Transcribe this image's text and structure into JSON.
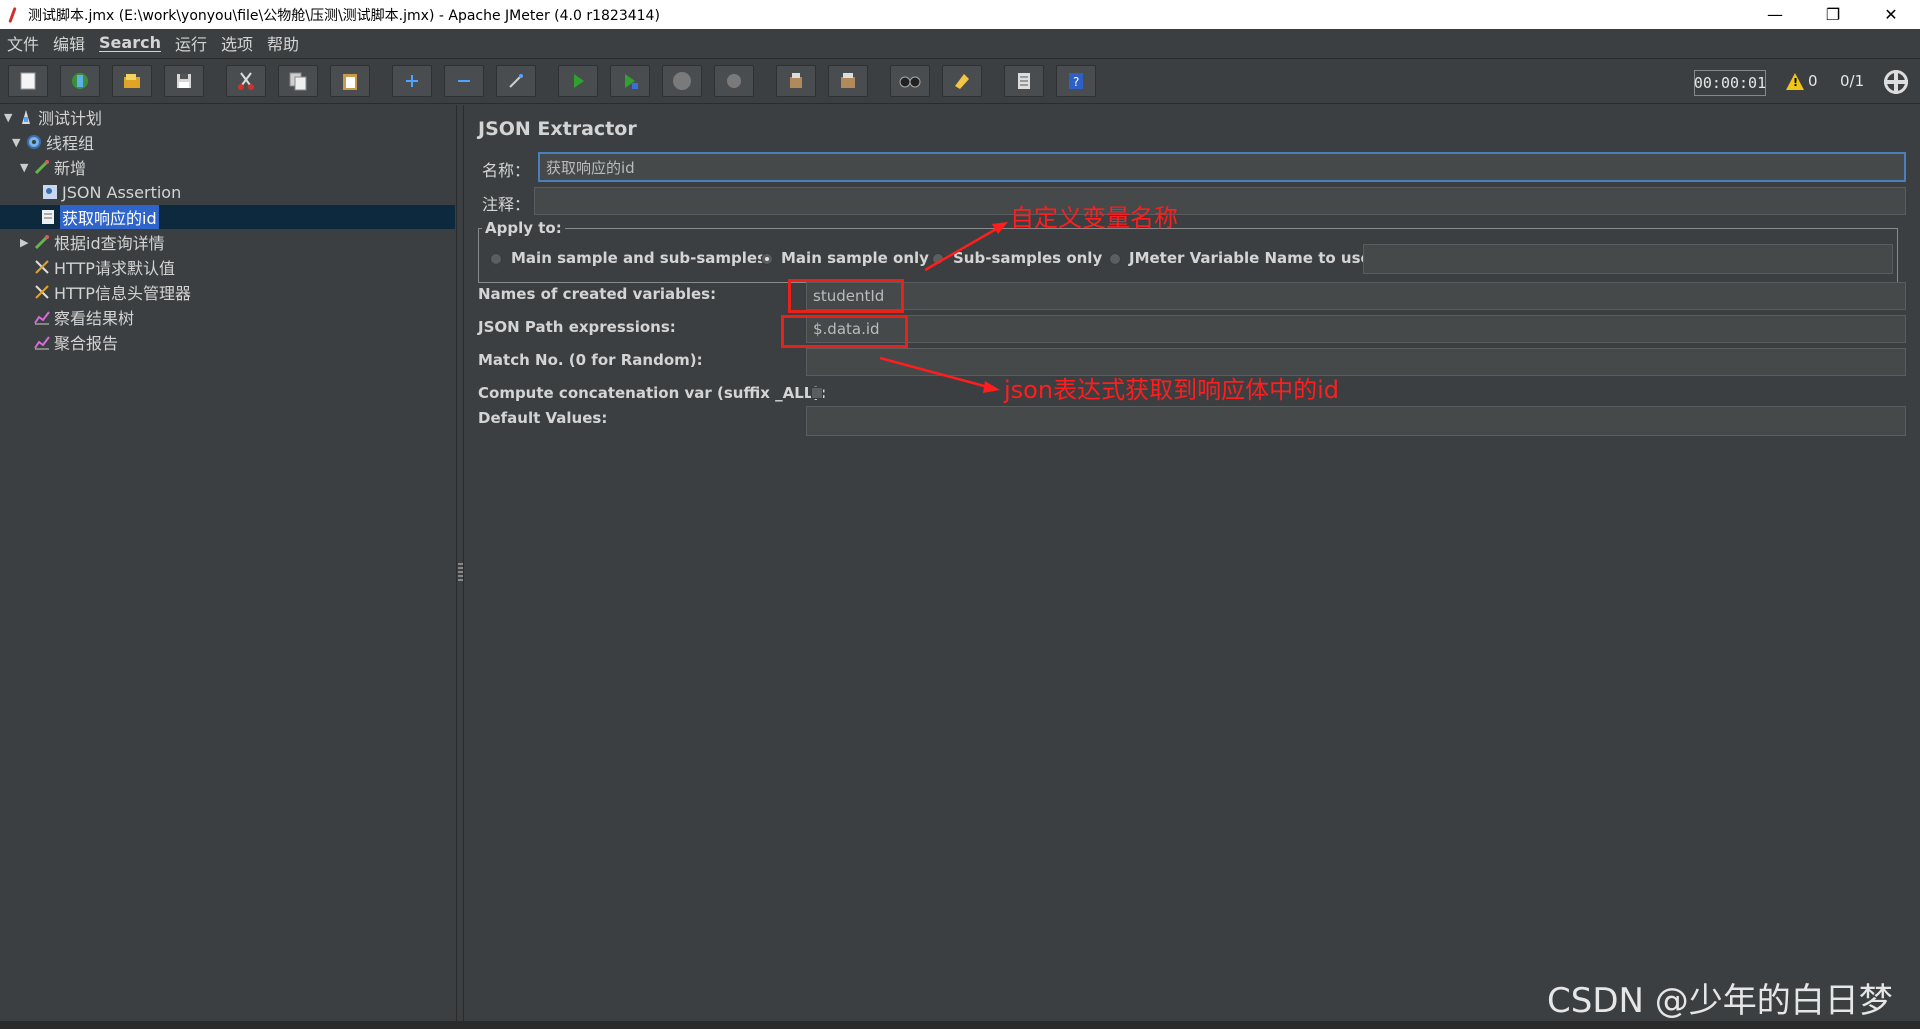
{
  "window": {
    "title": "测试脚本.jmx (E:\\work\\yonyou\\file\\公物舱\\压测\\测试脚本.jmx) - Apache JMeter (4.0 r1823414)",
    "minimize": "—",
    "maximize": "❐",
    "close": "✕"
  },
  "menu": [
    "文件",
    "编辑",
    "Search",
    "运行",
    "选项",
    "帮助"
  ],
  "toolbar": {
    "timer": "00:00:01",
    "warnings": "0",
    "threads": "0/1",
    "icons": [
      "new-icon",
      "templates-icon",
      "open-icon",
      "save-icon",
      "cut-icon",
      "copy-icon",
      "paste-icon",
      "expand-icon",
      "collapse-icon",
      "toggle-icon",
      "start-icon",
      "start-no-pause-icon",
      "stop-icon",
      "shutdown-icon",
      "clear-icon",
      "clear-all-icon",
      "search-icon",
      "reset-search-icon",
      "function-helper-icon",
      "help-icon"
    ]
  },
  "tree": [
    {
      "label": "测试计划",
      "icon": "test-plan-icon",
      "expanded": true
    },
    {
      "label": "线程组",
      "icon": "thread-group-icon",
      "expanded": true
    },
    {
      "label": "新增",
      "icon": "sampler-icon",
      "expanded": true
    },
    {
      "label": "JSON Assertion",
      "icon": "assertion-icon"
    },
    {
      "label": "获取响应的id",
      "icon": "extractor-icon",
      "selected": true
    },
    {
      "label": "根据id查询详情",
      "icon": "sampler-icon",
      "expanded": false
    },
    {
      "label": "HTTP请求默认值",
      "icon": "config-icon"
    },
    {
      "label": "HTTP信息头管理器",
      "icon": "config-icon"
    },
    {
      "label": "察看结果树",
      "icon": "listener-icon"
    },
    {
      "label": "聚合报告",
      "icon": "listener-icon"
    }
  ],
  "panel": {
    "title": "JSON Extractor",
    "name_label": "名称：",
    "name_value": "获取响应的id",
    "comment_label": "注释：",
    "comment_value": "",
    "apply_to": {
      "title": "Apply to:",
      "options": [
        "Main sample and sub-samples",
        "Main sample only",
        "Sub-samples only",
        "JMeter Variable Name to use"
      ],
      "selected": "Main sample only",
      "variable_value": ""
    },
    "fields": [
      {
        "label": "Names of created variables:",
        "value": "studentId"
      },
      {
        "label": "JSON Path expressions:",
        "value": "$.data.id"
      },
      {
        "label": "Match No. (0 for Random):",
        "value": ""
      },
      {
        "label": "Compute concatenation var (suffix _ALL):",
        "value": ""
      },
      {
        "label": "Default Values:",
        "value": ""
      }
    ],
    "concat_checked": false
  },
  "annotations": {
    "variable_name_note": "自定义变量名称",
    "json_path_note": "json表达式获取到响应体中的id",
    "color": "#ff1d1d"
  },
  "watermark": "CSDN @少年的白日梦"
}
